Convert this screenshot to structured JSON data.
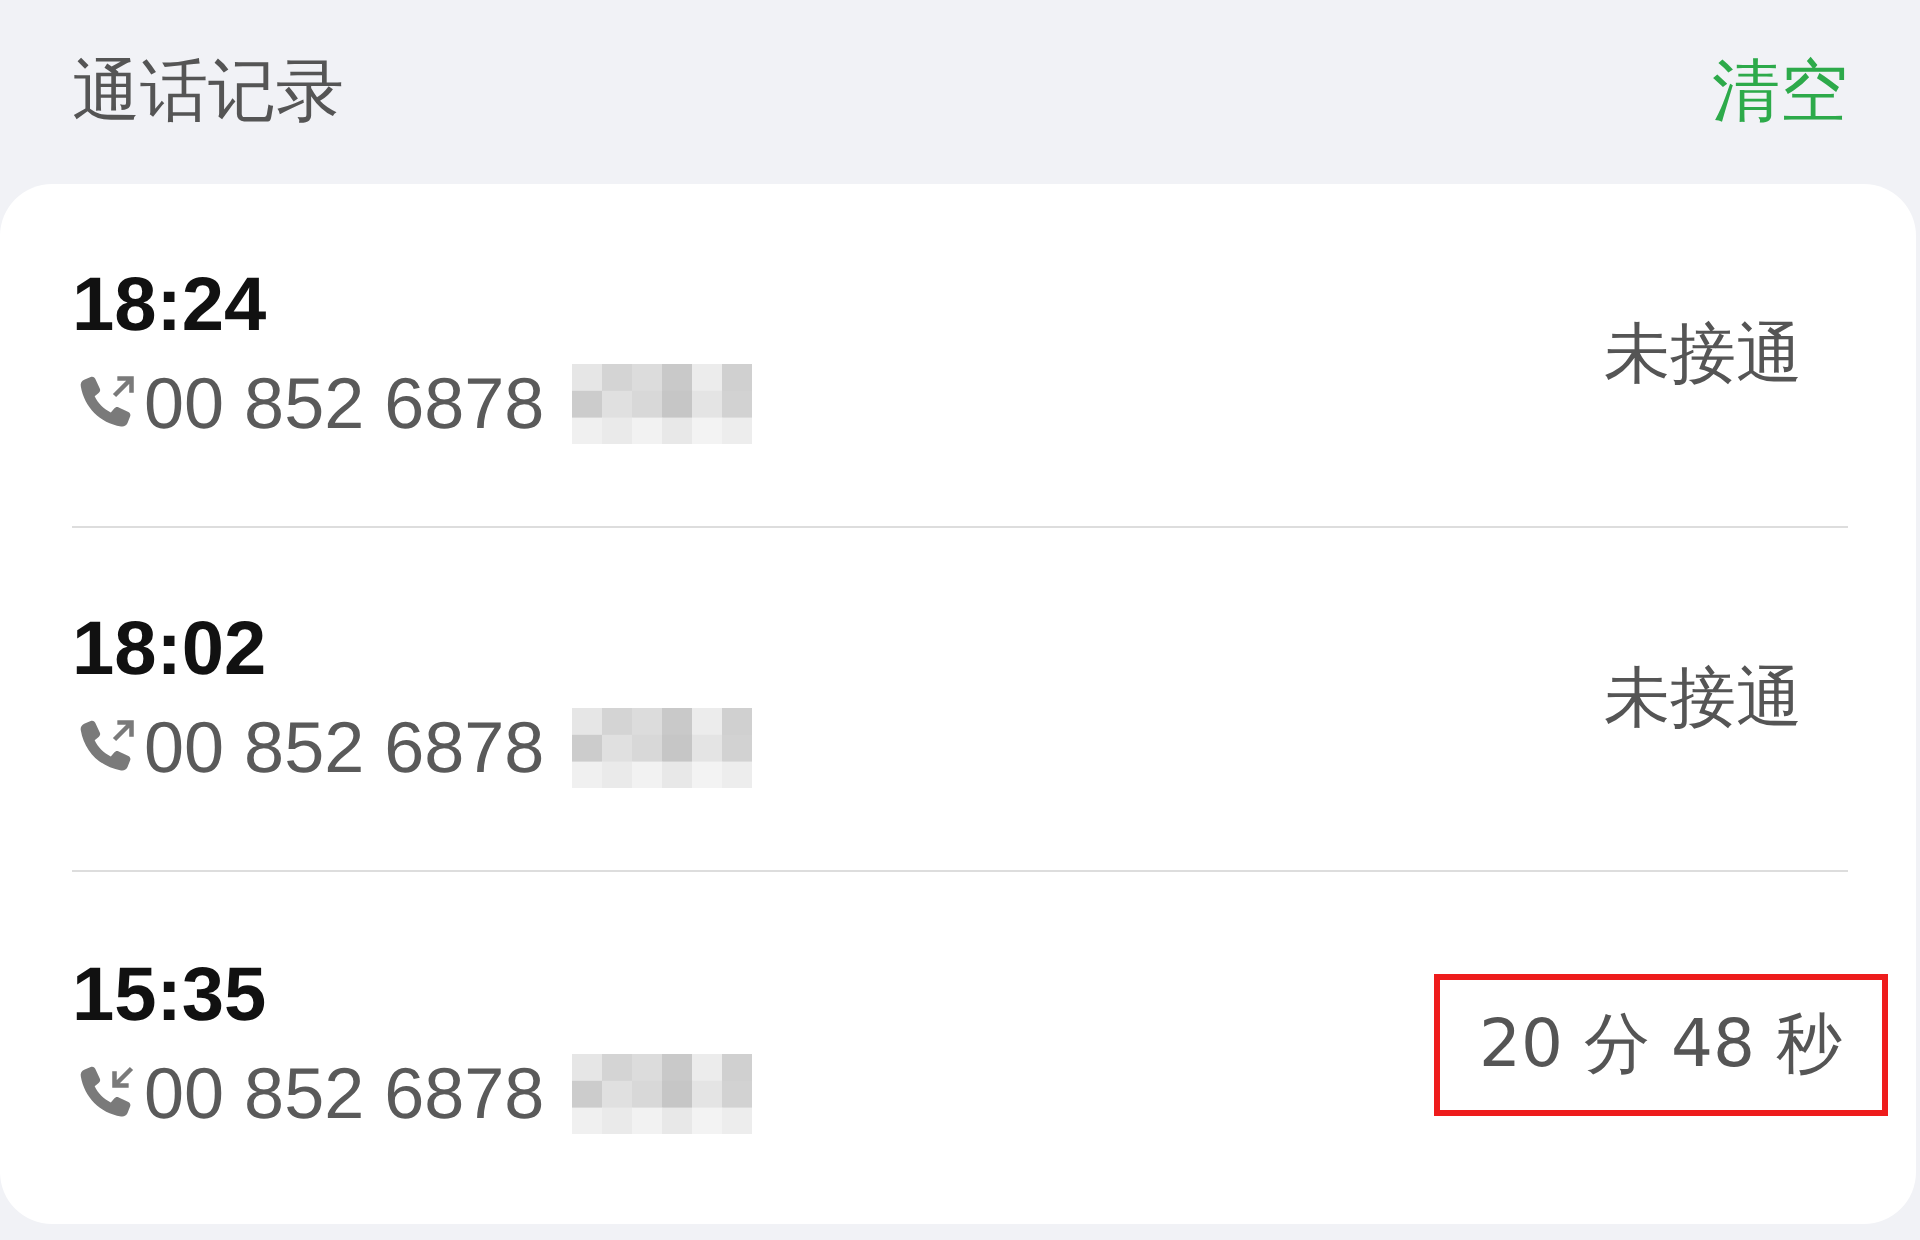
{
  "header": {
    "title": "通话记录",
    "action": "清空"
  },
  "calls": [
    {
      "time": "18:24",
      "kind": "outgoing",
      "number": "00 852 6878",
      "result": "未接通",
      "highlighted": false
    },
    {
      "time": "18:02",
      "kind": "outgoing",
      "number": "00 852 6878",
      "result": "未接通",
      "highlighted": false
    },
    {
      "time": "15:35",
      "kind": "incoming",
      "number": "00 852 6878",
      "result": "20 分 48 秒",
      "highlighted": true
    }
  ]
}
